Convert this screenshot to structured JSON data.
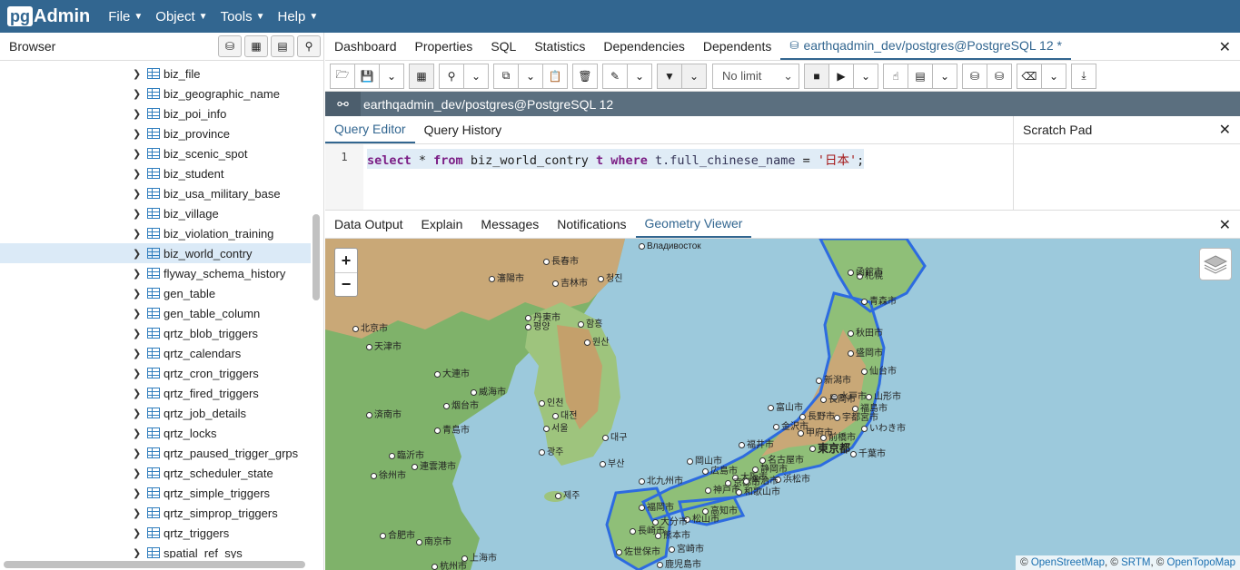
{
  "app": {
    "logo_prefix": "pg",
    "logo_suffix": "Admin"
  },
  "menu": [
    "File",
    "Object",
    "Tools",
    "Help"
  ],
  "browser": {
    "title": "Browser",
    "items": [
      "biz_file",
      "biz_geographic_name",
      "biz_poi_info",
      "biz_province",
      "biz_scenic_spot",
      "biz_student",
      "biz_usa_military_base",
      "biz_village",
      "biz_violation_training",
      "biz_world_contry",
      "flyway_schema_history",
      "gen_table",
      "gen_table_column",
      "qrtz_blob_triggers",
      "qrtz_calendars",
      "qrtz_cron_triggers",
      "qrtz_fired_triggers",
      "qrtz_job_details",
      "qrtz_locks",
      "qrtz_paused_trigger_grps",
      "qrtz_scheduler_state",
      "qrtz_simple_triggers",
      "qrtz_simprop_triggers",
      "qrtz_triggers",
      "spatial_ref_sys"
    ],
    "selected_index": 9
  },
  "tabs": [
    "Dashboard",
    "Properties",
    "SQL",
    "Statistics",
    "Dependencies",
    "Dependents"
  ],
  "active_tab": "earthqadmin_dev/postgres@PostgreSQL 12 *",
  "toolbar": {
    "limit_label": "No limit"
  },
  "connection": {
    "label": "earthqadmin_dev/postgres@PostgreSQL 12"
  },
  "editor": {
    "tabs": [
      "Query Editor",
      "Query History"
    ],
    "line_number": "1",
    "sql": {
      "kw1": "select",
      "star": " * ",
      "kw2": "from",
      "table": " biz_world_contry ",
      "alias": "t",
      "kw3": " where ",
      "col": "t.full_chinese_name",
      "eq": " = ",
      "value": "'日本'",
      "end": ";"
    }
  },
  "scratch_pad": {
    "title": "Scratch Pad"
  },
  "result_tabs": [
    "Data Output",
    "Explain",
    "Messages",
    "Notifications",
    "Geometry Viewer"
  ],
  "map": {
    "zoom_in": "+",
    "zoom_out": "−",
    "attribution": {
      "prefix": "©",
      "osm": "OpenStreetMap",
      "sep1": ", ©",
      "srtm": "SRTM",
      "sep2": ", ©",
      "otm": "OpenTopoMap"
    },
    "cities": [
      "東京都",
      "大阪市",
      "名古屋市",
      "札幌",
      "函館市",
      "青森市",
      "秋田市",
      "盛岡市",
      "仙台市",
      "新潟市",
      "長野市",
      "前橋市",
      "宇都宮市",
      "千葉市",
      "静岡市",
      "浜松市",
      "金沢市",
      "富山市",
      "福井市",
      "京都市",
      "神戸市",
      "岡山市",
      "広島市",
      "松山市",
      "高知市",
      "福岡市",
      "熊本市",
      "宮崎市",
      "鹿児島市",
      "北九州市",
      "長崎市",
      "北京市",
      "天津市",
      "大連市",
      "青島市",
      "済南市",
      "上海市",
      "南京市",
      "合肥市",
      "杭州市",
      "徐州市",
      "連雲港市",
      "臨沂市",
      "威海市",
      "烟台市",
      "丹東市",
      "瀋陽市",
      "長春市",
      "吉林市",
      "Владивосток",
      "서울",
      "인천",
      "대전",
      "대구",
      "부산",
      "광주",
      "제주",
      "평양",
      "원산",
      "함흥",
      "청진",
      "山形市",
      "福島市",
      "水戸市",
      "いわき市",
      "長岡市",
      "甲府市",
      "宇治市",
      "和歌山市",
      "佐世保市",
      "大分市"
    ]
  }
}
